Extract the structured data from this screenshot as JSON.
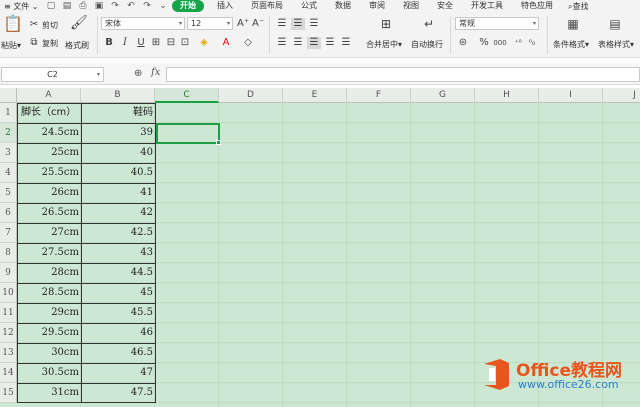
{
  "menubar": {
    "file_label": "文件",
    "tabs": [
      {
        "label": "开始",
        "active": true
      },
      {
        "label": "插入",
        "active": false
      },
      {
        "label": "页面布局",
        "active": false
      },
      {
        "label": "公式",
        "active": false
      },
      {
        "label": "数据",
        "active": false
      },
      {
        "label": "审阅",
        "active": false
      },
      {
        "label": "视图",
        "active": false
      },
      {
        "label": "安全",
        "active": false
      },
      {
        "label": "开发工具",
        "active": false
      },
      {
        "label": "特色应用",
        "active": false
      }
    ],
    "search_label": "查找"
  },
  "ribbon": {
    "paste": "粘贴",
    "cut": "剪切",
    "copy": "复制",
    "format_painter": "格式刷",
    "font_name": "宋体",
    "font_size": "12",
    "bold": "B",
    "italic": "I",
    "underline": "U",
    "merge_center": "合并居中",
    "wrap_text": "自动换行",
    "number_format": "常规",
    "percent": "%",
    "thousands": "000",
    "conditional_format": "条件格式",
    "table_style": "表格样式"
  },
  "formula_bar": {
    "cell_ref": "C2",
    "fx": "fx",
    "value": ""
  },
  "columns": [
    "A",
    "B",
    "C",
    "D",
    "E",
    "F",
    "G",
    "H",
    "I",
    "J"
  ],
  "rows": [
    "1",
    "2",
    "3",
    "4",
    "5",
    "6",
    "7",
    "8",
    "9",
    "10",
    "11",
    "12",
    "13",
    "14",
    "15"
  ],
  "selected_cell": "C2",
  "table": {
    "header": {
      "a": "脚长（cm）",
      "b": "鞋码"
    },
    "data": [
      {
        "a": "24.5cm",
        "b": "39"
      },
      {
        "a": "25cm",
        "b": "40"
      },
      {
        "a": "25.5cm",
        "b": "40.5"
      },
      {
        "a": "26cm",
        "b": "41"
      },
      {
        "a": "26.5cm",
        "b": "42"
      },
      {
        "a": "27cm",
        "b": "42.5"
      },
      {
        "a": "27.5cm",
        "b": "43"
      },
      {
        "a": "28cm",
        "b": "44.5"
      },
      {
        "a": "28.5cm",
        "b": "45"
      },
      {
        "a": "29cm",
        "b": "45.5"
      },
      {
        "a": "29.5cm",
        "b": "46"
      },
      {
        "a": "30cm",
        "b": "46.5"
      },
      {
        "a": "30.5cm",
        "b": "47"
      },
      {
        "a": "31cm",
        "b": "47.5"
      }
    ]
  },
  "watermark": {
    "title": "Office教程网",
    "url": "www.office26.com"
  },
  "colors": {
    "accent": "#16a34a",
    "grid_bg": "#cde8d2",
    "selection": "#1e9e45",
    "watermark_orange": "#e8561f",
    "watermark_blue": "#2a7fc9"
  }
}
